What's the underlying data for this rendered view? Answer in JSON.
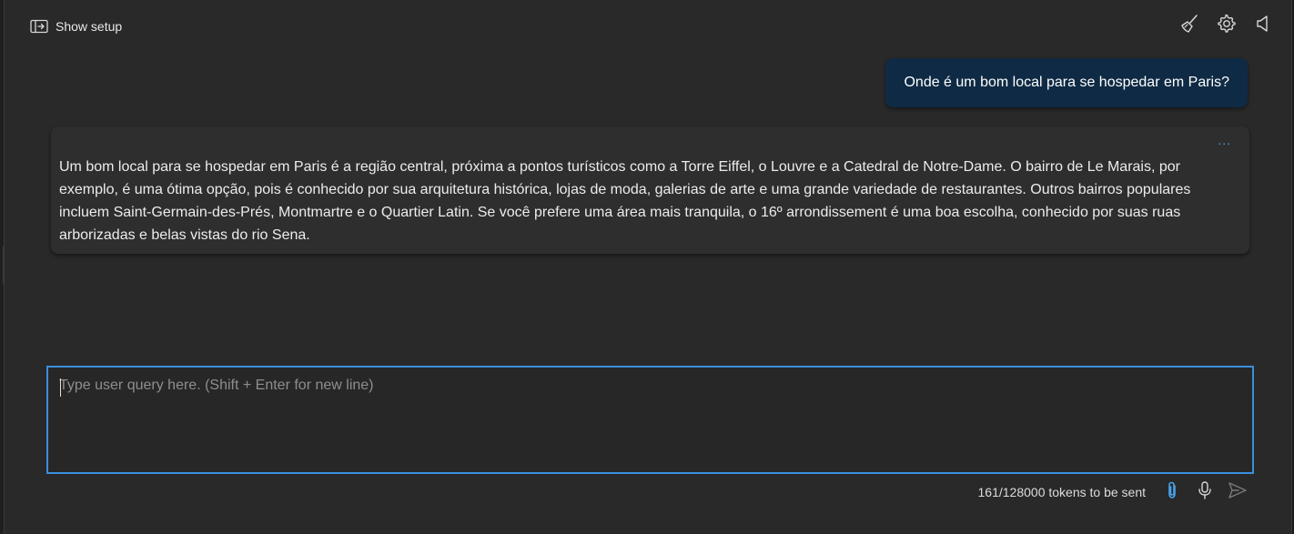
{
  "header": {
    "setup_label": "Show setup",
    "setup_icon": "panel-open-icon",
    "icons": [
      "broom-icon",
      "gear-icon",
      "speaker-icon"
    ]
  },
  "conversation": {
    "user_message": "Onde é um bom local para se hospedar em Paris?",
    "assistant_more": "...",
    "assistant_message": "Um bom local para se hospedar em Paris é a região central, próxima a pontos turísticos como a Torre Eiffel, o Louvre e a Catedral de Notre-Dame. O bairro de Le Marais, por exemplo, é uma ótima opção, pois é conhecido por sua arquitetura histórica, lojas de moda, galerias de arte e uma grande variedade de restaurantes. Outros bairros populares incluem Saint-Germain-des-Prés, Montmartre e o Quartier Latin. Se você prefere uma área mais tranquila, o 16º arrondissement é uma boa escolha, conhecido por suas ruas arborizadas e belas vistas do rio Sena."
  },
  "input": {
    "placeholder": "Type user query here. (Shift + Enter for new line)",
    "value": ""
  },
  "footer": {
    "token_count": "161/128000 tokens to be sent",
    "icons": [
      "paperclip-icon",
      "microphone-icon",
      "send-icon"
    ]
  },
  "colors": {
    "panel_bg": "#292929",
    "user_bubble": "#0f2a44",
    "assistant_bubble": "#2e2e2e",
    "accent": "#3b8edb",
    "attach_icon": "#4aa3e8"
  }
}
